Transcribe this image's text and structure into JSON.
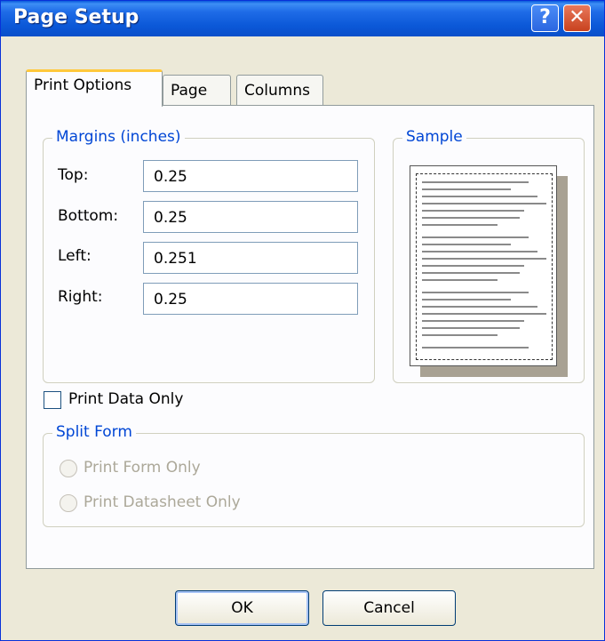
{
  "window": {
    "title": "Page Setup",
    "help_glyph": "?",
    "close_glyph": "✕"
  },
  "tabs": [
    {
      "label": "Print Options"
    },
    {
      "label": "Page"
    },
    {
      "label": "Columns"
    }
  ],
  "margins": {
    "legend": "Margins (inches)",
    "top": {
      "label": "Top:",
      "value": "0.25"
    },
    "bottom": {
      "label": "Bottom:",
      "value": "0.25"
    },
    "left": {
      "label": "Left:",
      "value": "0.251"
    },
    "right": {
      "label": "Right:",
      "value": "0.25"
    }
  },
  "sample": {
    "legend": "Sample"
  },
  "print_data_only": {
    "label": "Print Data Only",
    "checked": false
  },
  "split_form": {
    "legend": "Split Form",
    "option1": "Print Form Only",
    "option2": "Print Datasheet Only"
  },
  "buttons": {
    "ok": "OK",
    "cancel": "Cancel"
  },
  "colors": {
    "title_bar": "#0a5bdc",
    "group_label": "#0046d5",
    "tab_highlight": "#ffc83c",
    "dialog_bg": "#ece9d8"
  }
}
